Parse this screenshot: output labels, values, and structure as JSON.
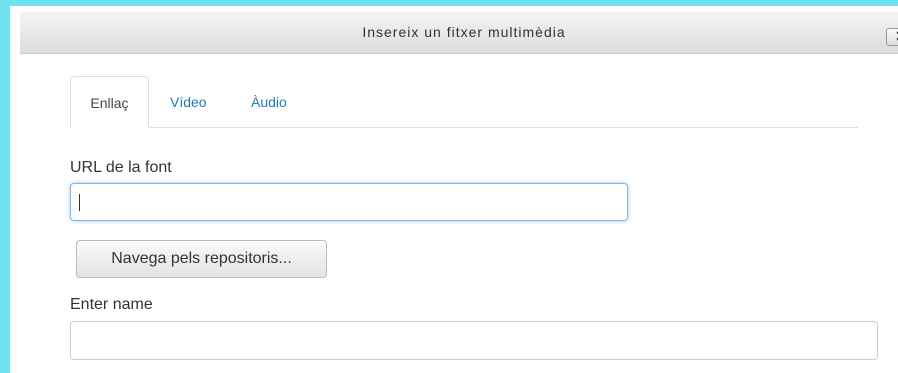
{
  "dialog": {
    "title": "Insereix un fitxer multimèdia",
    "close_label": "✕"
  },
  "tabs": [
    {
      "label": "Enllaç",
      "active": true
    },
    {
      "label": "Vídeo",
      "active": false
    },
    {
      "label": "Àudio",
      "active": false
    }
  ],
  "form": {
    "url_label": "URL de la font",
    "url_value": "",
    "browse_label": "Navega pels repositoris...",
    "name_label": "Enter name",
    "name_value": ""
  },
  "colors": {
    "frame_accent": "#6fe2f0",
    "link": "#1f7bb6",
    "focus_border": "#7ab7e8"
  }
}
